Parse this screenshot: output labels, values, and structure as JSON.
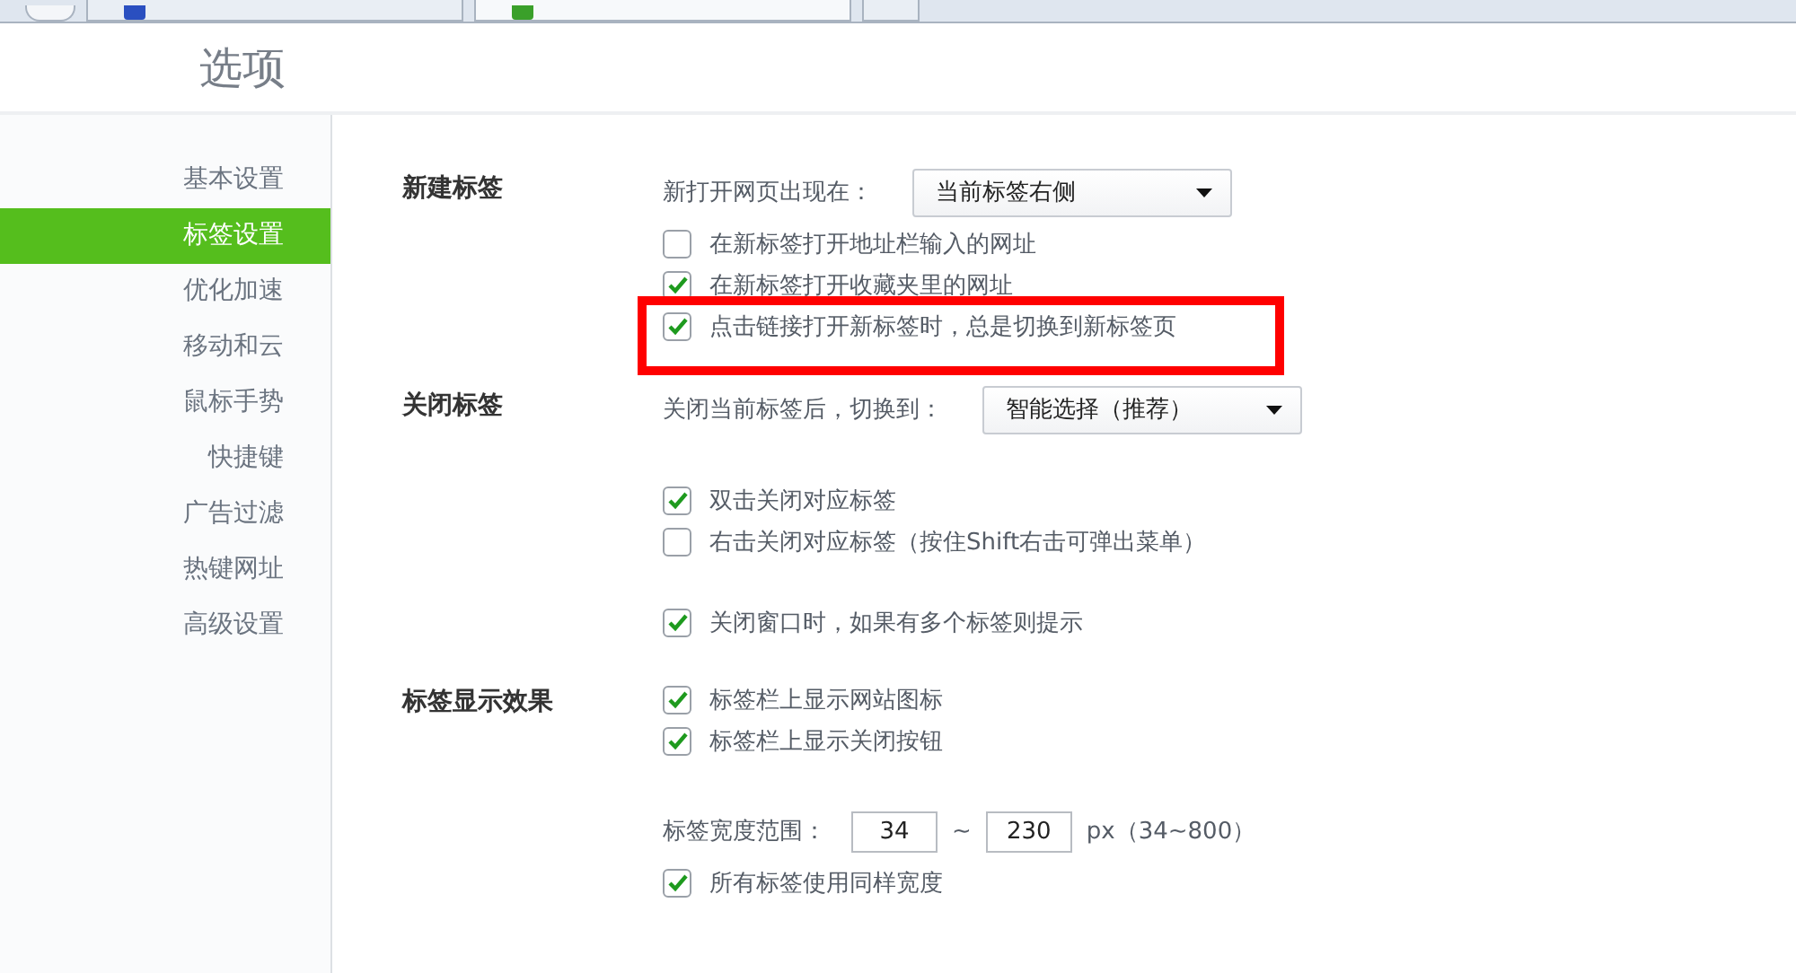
{
  "browser_tabs": [
    {
      "color": "#2a4fc0",
      "selected": false
    },
    {
      "color": "#3aa02a",
      "selected": true
    }
  ],
  "page_title": "选项",
  "sidebar": {
    "items": [
      {
        "label": "基本设置",
        "selected": false
      },
      {
        "label": "标签设置",
        "selected": true
      },
      {
        "label": "优化加速",
        "selected": false
      },
      {
        "label": "移动和云",
        "selected": false
      },
      {
        "label": "鼠标手势",
        "selected": false
      },
      {
        "label": "快捷键",
        "selected": false
      },
      {
        "label": "广告过滤",
        "selected": false
      },
      {
        "label": "热键网址",
        "selected": false
      },
      {
        "label": "高级设置",
        "selected": false
      }
    ]
  },
  "sections": [
    {
      "title": "新建标签",
      "rows": [
        {
          "kind": "select",
          "label": "新打开网页出现在：",
          "value": "当前标签右侧"
        },
        {
          "kind": "checkbox",
          "label": "在新标签打开地址栏输入的网址",
          "checked": false,
          "highlighted": false
        },
        {
          "kind": "checkbox",
          "label": "在新标签打开收藏夹里的网址",
          "checked": true,
          "highlighted": false
        },
        {
          "kind": "checkbox",
          "label": "点击链接打开新标签时，总是切换到新标签页",
          "checked": true,
          "highlighted": true
        }
      ]
    },
    {
      "title": "关闭标签",
      "rows": [
        {
          "kind": "select",
          "label": "关闭当前标签后，切换到：",
          "value": "智能选择（推荐）"
        },
        {
          "kind": "spacer"
        },
        {
          "kind": "checkbox",
          "label": "双击关闭对应标签",
          "checked": true,
          "highlighted": false
        },
        {
          "kind": "checkbox",
          "label": "右击关闭对应标签（按住Shift右击可弹出菜单）",
          "checked": false,
          "highlighted": false
        },
        {
          "kind": "spacer"
        },
        {
          "kind": "checkbox",
          "label": "关闭窗口时，如果有多个标签则提示",
          "checked": true,
          "highlighted": false
        }
      ]
    },
    {
      "title": "标签显示效果",
      "rows": [
        {
          "kind": "checkbox",
          "label": "标签栏上显示网站图标",
          "checked": true,
          "highlighted": false
        },
        {
          "kind": "checkbox",
          "label": "标签栏上显示关闭按钮",
          "checked": true,
          "highlighted": false
        },
        {
          "kind": "spacer"
        },
        {
          "kind": "range",
          "label": "标签宽度范围：",
          "min": "34",
          "separator": "~",
          "max": "230",
          "unit": "px（34~800）"
        },
        {
          "kind": "checkbox",
          "label": "所有标签使用同样宽度",
          "checked": true,
          "highlighted": false
        }
      ]
    }
  ]
}
